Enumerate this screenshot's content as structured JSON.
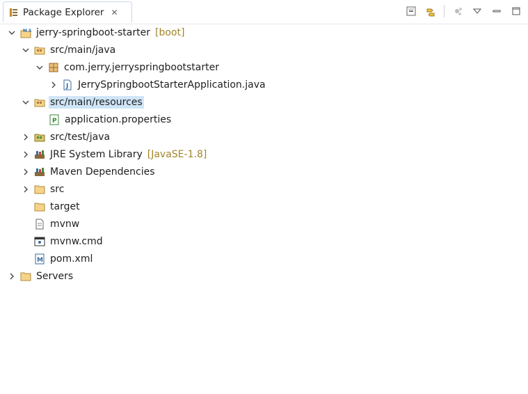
{
  "view": {
    "title": "Package Explorer",
    "close_glyph": "✕"
  },
  "toolbar": {
    "buttons": [
      "collapse-all-icon",
      "link-with-editor-icon",
      "focus-icon",
      "view-menu-icon",
      "minimize-icon",
      "maximize-icon"
    ]
  },
  "tree": [
    {
      "label": "jerry-springboot-starter",
      "decoration": "[boot]",
      "icon": "spring-project-icon",
      "expanded": true
    },
    {
      "label": "src/main/java",
      "icon": "source-folder-icon",
      "expanded": true
    },
    {
      "label": "com.jerry.jerryspringbootstarter",
      "icon": "package-icon",
      "expanded": true
    },
    {
      "label": "JerrySpringbootStarterApplication.java",
      "icon": "java-file-icon",
      "expanded": false
    },
    {
      "label": "src/main/resources",
      "icon": "source-folder-icon",
      "expanded": true,
      "selected": true
    },
    {
      "label": "application.properties",
      "icon": "properties-file-icon"
    },
    {
      "label": "src/test/java",
      "icon": "test-source-folder-icon",
      "expanded": false
    },
    {
      "label": "JRE System Library",
      "decoration": "[JavaSE-1.8]",
      "icon": "library-icon",
      "expanded": false
    },
    {
      "label": "Maven Dependencies",
      "icon": "library-icon",
      "expanded": false
    },
    {
      "label": "src",
      "icon": "folder-icon",
      "expanded": false
    },
    {
      "label": "target",
      "icon": "folder-icon"
    },
    {
      "label": "mvnw",
      "icon": "text-file-icon"
    },
    {
      "label": "mvnw.cmd",
      "icon": "cmd-file-icon"
    },
    {
      "label": "pom.xml",
      "icon": "maven-pom-icon"
    },
    {
      "label": "Servers",
      "icon": "folder-icon",
      "expanded": false
    }
  ]
}
